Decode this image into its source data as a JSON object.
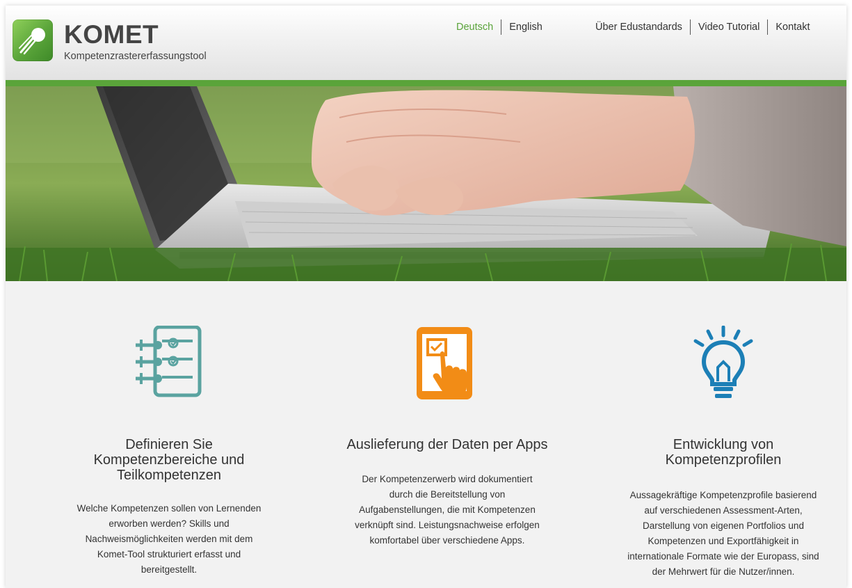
{
  "brand": {
    "title": "KOMET",
    "subtitle": "Kompetenzrastererfassungstool",
    "accent_color": "#5aa43a"
  },
  "language_nav": [
    {
      "label": "Deutsch",
      "active": true
    },
    {
      "label": "English",
      "active": false
    }
  ],
  "main_nav": [
    {
      "label": "Über Edustandards"
    },
    {
      "label": "Video Tutorial"
    },
    {
      "label": "Kontakt"
    }
  ],
  "hero": {
    "image": "hands-typing-on-laptop-in-grass"
  },
  "features": [
    {
      "icon": "checklist-icon",
      "icon_color": "#5aa3a0",
      "title_lines": [
        "Definieren Sie",
        "Kompetenzbereiche und",
        "Teilkompetenzen"
      ],
      "text_lines": [
        "Welche Kompetenzen sollen von Lernenden",
        "erworben werden? Skills und",
        "Nachweismöglichkeiten werden mit dem",
        "Komet-Tool strukturiert erfasst und",
        "bereitgestellt."
      ]
    },
    {
      "icon": "tablet-touch-icon",
      "icon_color": "#f28c16",
      "title_lines": [
        "Auslieferung der Daten per Apps"
      ],
      "text_lines": [
        "Der Kompetenzerwerb wird dokumentiert",
        "durch die Bereitstellung von",
        "Aufgabenstellungen, die mit Kompetenzen",
        "verknüpft sind. Leistungsnachweise erfolgen",
        "komfortabel über verschiedene Apps."
      ]
    },
    {
      "icon": "lightbulb-icon",
      "icon_color": "#1c7fb6",
      "title_lines": [
        "Entwicklung von",
        "Kompetenzprofilen"
      ],
      "text_lines": [
        "Aussagekräftige Kompetenzprofile basierend",
        "auf verschiedenen Assessment-Arten,",
        "Darstellung von eigenen Portfolios und",
        "Kompetenzen und Exportfähigkeit in",
        "internationale Formate wie der Europass, sind",
        "der Mehrwert für die Nutzer/innen."
      ]
    }
  ]
}
